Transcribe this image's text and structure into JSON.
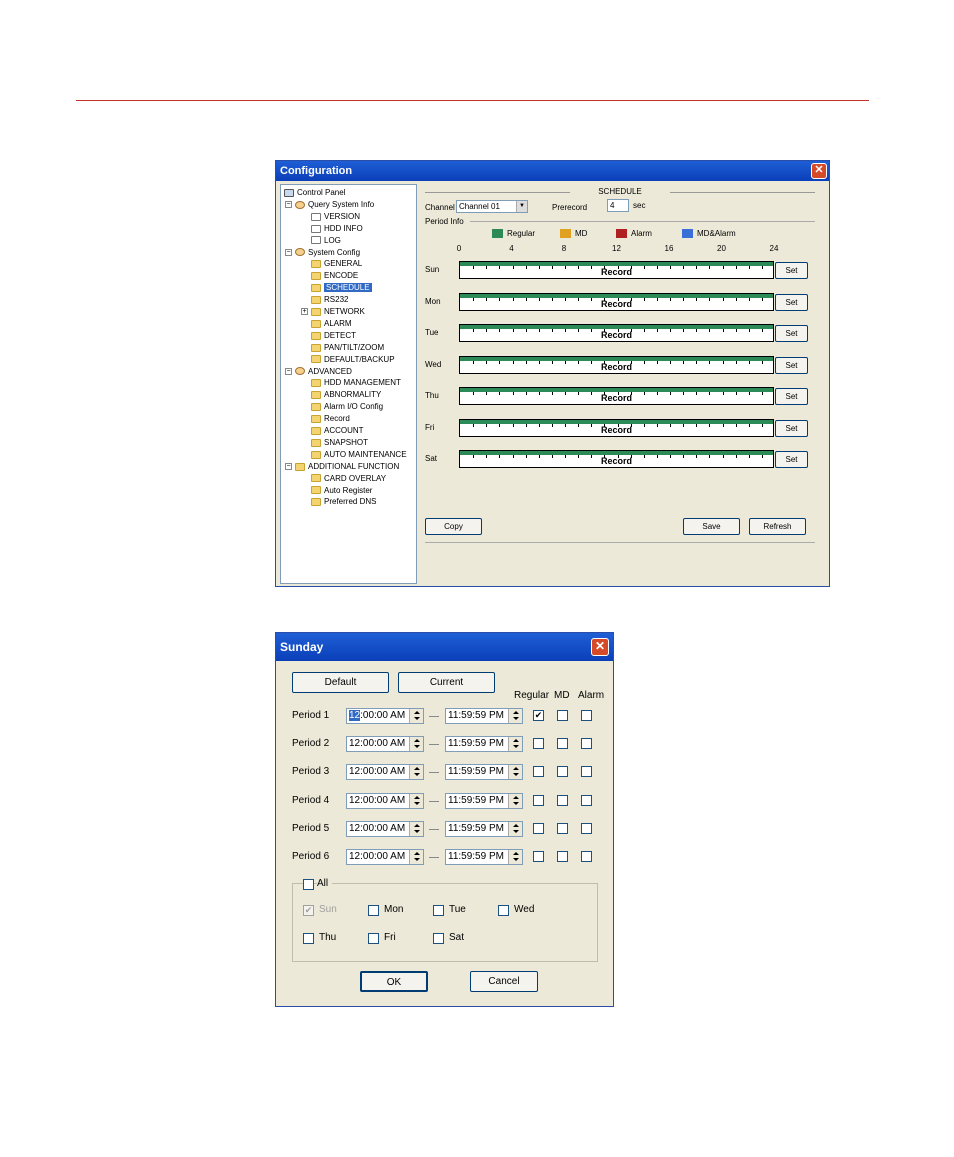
{
  "config": {
    "title": "Configuration",
    "close": "✕",
    "tree": [
      {
        "label": "Control Panel",
        "icon": "monitor-icon"
      },
      {
        "label": "Query System Info",
        "icon": "info-icon"
      },
      {
        "label": "VERSION",
        "icon": "doc-icon"
      },
      {
        "label": "HDD INFO",
        "icon": "doc-icon"
      },
      {
        "label": "LOG",
        "icon": "doc-icon"
      },
      {
        "label": "System Config",
        "icon": "tools-icon"
      },
      {
        "label": "GENERAL",
        "icon": "folder-icon"
      },
      {
        "label": "ENCODE",
        "icon": "folder-icon"
      },
      {
        "label": "SCHEDULE",
        "icon": "folder-icon"
      },
      {
        "label": "RS232",
        "icon": "folder-icon"
      },
      {
        "label": "NETWORK",
        "icon": "folder-icon"
      },
      {
        "label": "ALARM",
        "icon": "folder-icon"
      },
      {
        "label": "DETECT",
        "icon": "folder-icon"
      },
      {
        "label": "PAN/TILT/ZOOM",
        "icon": "folder-icon"
      },
      {
        "label": "DEFAULT/BACKUP",
        "icon": "folder-icon"
      },
      {
        "label": "ADVANCED",
        "icon": "gear-icon"
      },
      {
        "label": "HDD MANAGEMENT",
        "icon": "folder-icon"
      },
      {
        "label": "ABNORMALITY",
        "icon": "folder-icon"
      },
      {
        "label": "Alarm I/O Config",
        "icon": "folder-icon"
      },
      {
        "label": "Record",
        "icon": "folder-icon"
      },
      {
        "label": "ACCOUNT",
        "icon": "folder-icon"
      },
      {
        "label": "SNAPSHOT",
        "icon": "folder-icon"
      },
      {
        "label": "AUTO MAINTENANCE",
        "icon": "folder-icon"
      },
      {
        "label": "ADDITIONAL FUNCTION",
        "icon": "folder-icon"
      },
      {
        "label": "CARD OVERLAY",
        "icon": "folder-icon"
      },
      {
        "label": "Auto Register",
        "icon": "folder-icon"
      },
      {
        "label": "Preferred DNS",
        "icon": "folder-icon"
      }
    ],
    "schedule": {
      "heading": "SCHEDULE",
      "channel_label": "Channel",
      "channel_value": "Channel 01",
      "prerecord_label": "Prerecord",
      "prerecord_value": "4",
      "prerecord_unit": "sec",
      "period_info": "Period Info",
      "legend": [
        {
          "label": "Regular",
          "color": "#2c8a57"
        },
        {
          "label": "MD",
          "color": "#e0a020"
        },
        {
          "label": "Alarm",
          "color": "#b02020"
        },
        {
          "label": "MD&Alarm",
          "color": "#3a6fd8"
        }
      ],
      "hours": [
        "0",
        "4",
        "8",
        "12",
        "16",
        "20",
        "24"
      ],
      "days": [
        {
          "name": "Sun",
          "bar": "Record",
          "set": "Set"
        },
        {
          "name": "Mon",
          "bar": "Record",
          "set": "Set"
        },
        {
          "name": "Tue",
          "bar": "Record",
          "set": "Set"
        },
        {
          "name": "Wed",
          "bar": "Record",
          "set": "Set"
        },
        {
          "name": "Thu",
          "bar": "Record",
          "set": "Set"
        },
        {
          "name": "Fri",
          "bar": "Record",
          "set": "Set"
        },
        {
          "name": "Sat",
          "bar": "Record",
          "set": "Set"
        }
      ],
      "copy": "Copy",
      "save": "Save",
      "refresh": "Refresh"
    }
  },
  "sunday": {
    "title": "Sunday",
    "close": "✕",
    "default_btn": "Default",
    "current_btn": "Current",
    "col_regular": "Regular",
    "col_md": "MD",
    "col_alarm": "Alarm",
    "periods": [
      {
        "label": "Period 1",
        "start_hl": "12",
        "start": ":00:00 AM",
        "end": "11:59:59 PM",
        "regular": "✔",
        "md": "",
        "alarm": ""
      },
      {
        "label": "Period 2",
        "start_hl": "",
        "start": "12:00:00 AM",
        "end": "11:59:59 PM",
        "regular": "",
        "md": "",
        "alarm": ""
      },
      {
        "label": "Period 3",
        "start_hl": "",
        "start": "12:00:00 AM",
        "end": "11:59:59 PM",
        "regular": "",
        "md": "",
        "alarm": ""
      },
      {
        "label": "Period 4",
        "start_hl": "",
        "start": "12:00:00 AM",
        "end": "11:59:59 PM",
        "regular": "",
        "md": "",
        "alarm": ""
      },
      {
        "label": "Period 5",
        "start_hl": "",
        "start": "12:00:00 AM",
        "end": "11:59:59 PM",
        "regular": "",
        "md": "",
        "alarm": ""
      },
      {
        "label": "Period 6",
        "start_hl": "",
        "start": "12:00:00 AM",
        "end": "11:59:59 PM",
        "regular": "",
        "md": "",
        "alarm": ""
      }
    ],
    "all_label": "All",
    "weekdays": [
      {
        "label": "Sun",
        "checked": "✔"
      },
      {
        "label": "Mon",
        "checked": ""
      },
      {
        "label": "Tue",
        "checked": ""
      },
      {
        "label": "Wed",
        "checked": ""
      },
      {
        "label": "Thu",
        "checked": ""
      },
      {
        "label": "Fri",
        "checked": ""
      },
      {
        "label": "Sat",
        "checked": ""
      }
    ],
    "ok": "OK",
    "cancel": "Cancel"
  }
}
